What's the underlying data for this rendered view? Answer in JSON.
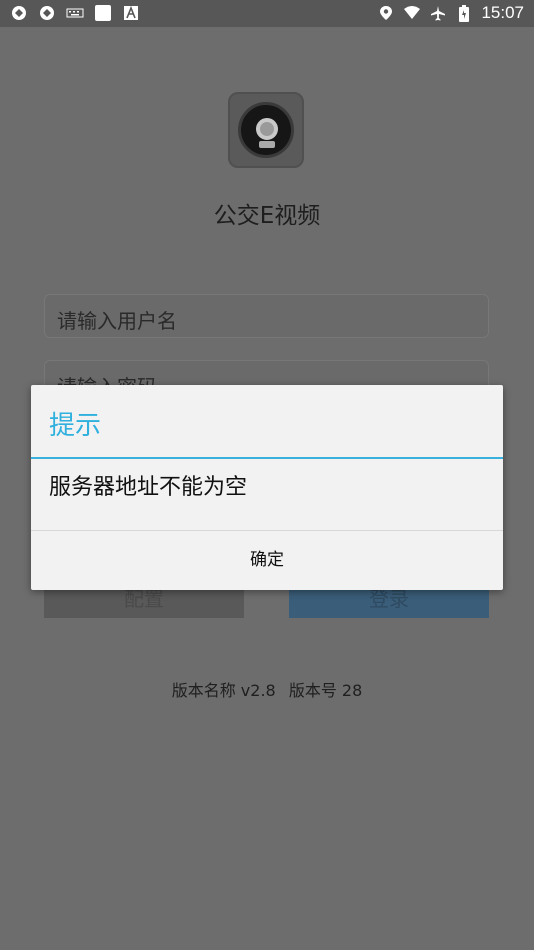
{
  "status_bar": {
    "time": "15:07",
    "icons_left": [
      "sync-icon",
      "sync-icon",
      "keyboard-icon",
      "square-icon",
      "text-a-icon"
    ],
    "icons_right": [
      "location-icon",
      "wifi-icon",
      "airplane-icon",
      "battery-icon"
    ]
  },
  "app": {
    "title": "公交E视频",
    "username_placeholder": "请输入用户名",
    "password_placeholder": "请输入密码",
    "config_button": "配置",
    "login_button": "登录",
    "version_name": "版本名称 v2.8",
    "version_code": "版本号 28"
  },
  "dialog": {
    "title": "提示",
    "message": "服务器地址不能为空",
    "confirm_button": "确定",
    "accent_color": "#2fb0de"
  }
}
